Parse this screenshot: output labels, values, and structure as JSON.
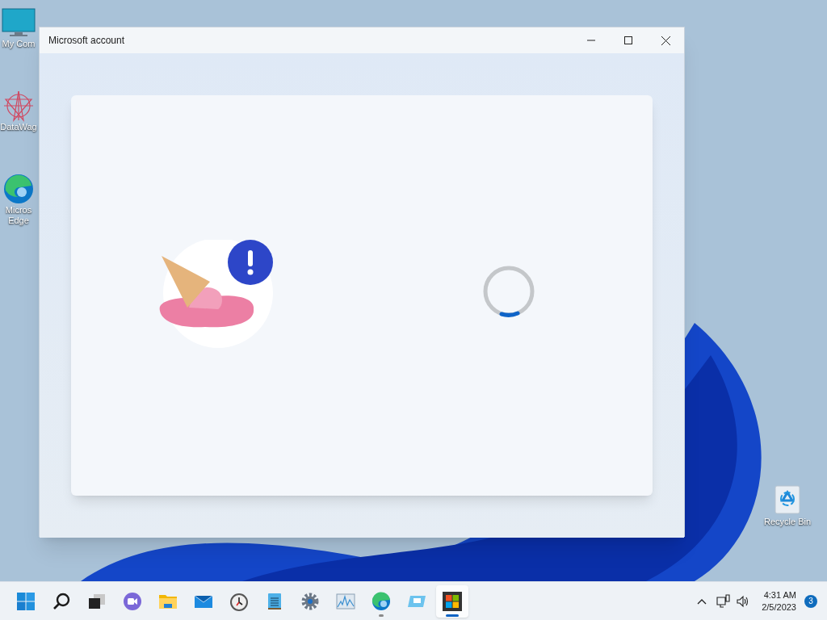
{
  "desktop_icons": [
    {
      "kind": "computer",
      "label": "My Com"
    },
    {
      "kind": "datawag",
      "label": "DataWag"
    },
    {
      "kind": "edge",
      "label": "Micros Edge"
    },
    {
      "kind": "recycle",
      "label": "Recycle Bin"
    }
  ],
  "window": {
    "title": "Microsoft account"
  },
  "taskbar": {
    "apps": [
      {
        "kind": "start",
        "running": false,
        "selected": false
      },
      {
        "kind": "search",
        "running": false,
        "selected": false
      },
      {
        "kind": "taskview",
        "running": false,
        "selected": false
      },
      {
        "kind": "chat",
        "running": false,
        "selected": false
      },
      {
        "kind": "explorer",
        "running": false,
        "selected": false
      },
      {
        "kind": "mail",
        "running": false,
        "selected": false
      },
      {
        "kind": "clock",
        "running": false,
        "selected": false
      },
      {
        "kind": "notepad",
        "running": false,
        "selected": false
      },
      {
        "kind": "settings",
        "running": false,
        "selected": false
      },
      {
        "kind": "monitor",
        "running": false,
        "selected": false
      },
      {
        "kind": "edge",
        "running": true,
        "selected": false
      },
      {
        "kind": "remote",
        "running": false,
        "selected": false
      },
      {
        "kind": "store",
        "running": true,
        "selected": true
      }
    ],
    "time": "4:31 AM",
    "date": "2/5/2023",
    "notifications": "3"
  }
}
